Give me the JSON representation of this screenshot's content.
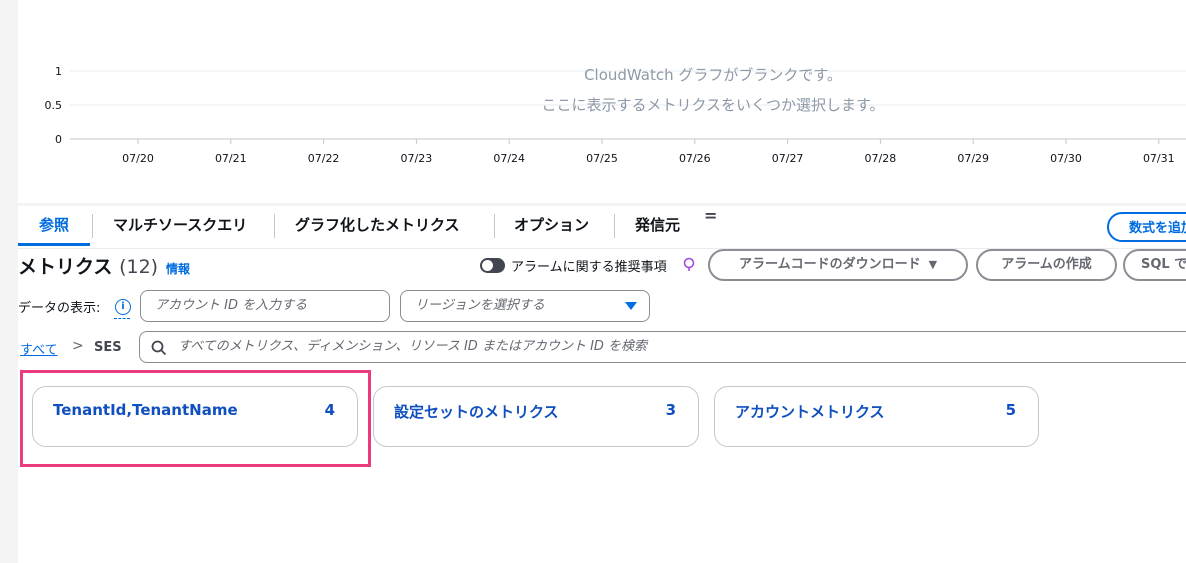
{
  "graph": {
    "y_ticks": [
      "1",
      "0.5",
      "0"
    ],
    "x_ticks": [
      "07/20",
      "07/21",
      "07/22",
      "07/23",
      "07/24",
      "07/25",
      "07/26",
      "07/27",
      "07/28",
      "07/29",
      "07/30",
      "07/31"
    ],
    "blank_line1": "CloudWatch グラフがブランクです。",
    "blank_line2": "ここに表示するメトリクスをいくつか選択します。"
  },
  "tabs": [
    "参照",
    "マルチソースクエリ",
    "グラフ化したメトリクス",
    "オプション",
    "発信元"
  ],
  "tab_menu_icon": "=",
  "math_button": "数式を追加",
  "heading": {
    "title": "メトリクス",
    "count": "(12)",
    "info": "情報"
  },
  "alarm_toggle_label": "アラームに関する推奨事項",
  "buttons": {
    "download": "アラームコードのダウンロード",
    "create_alarm": "アラームの作成",
    "sql": "SQL で"
  },
  "filters": {
    "display_label": "データの表示:",
    "account_placeholder": "アカウント ID を入力する",
    "region_placeholder": "リージョンを選択する"
  },
  "breadcrumb": {
    "all": "すべて",
    "current": "SES"
  },
  "search_placeholder": "すべてのメトリクス、ディメンション、リソース ID またはアカウント ID を検索",
  "cards": [
    {
      "title": "TenantId,TenantName",
      "count": "4"
    },
    {
      "title": "設定セットのメトリクス",
      "count": "3"
    },
    {
      "title": "アカウントメトリクス",
      "count": "5"
    }
  ],
  "colors": {
    "accent": "#006ce0",
    "highlight": "#eb3a7d"
  }
}
